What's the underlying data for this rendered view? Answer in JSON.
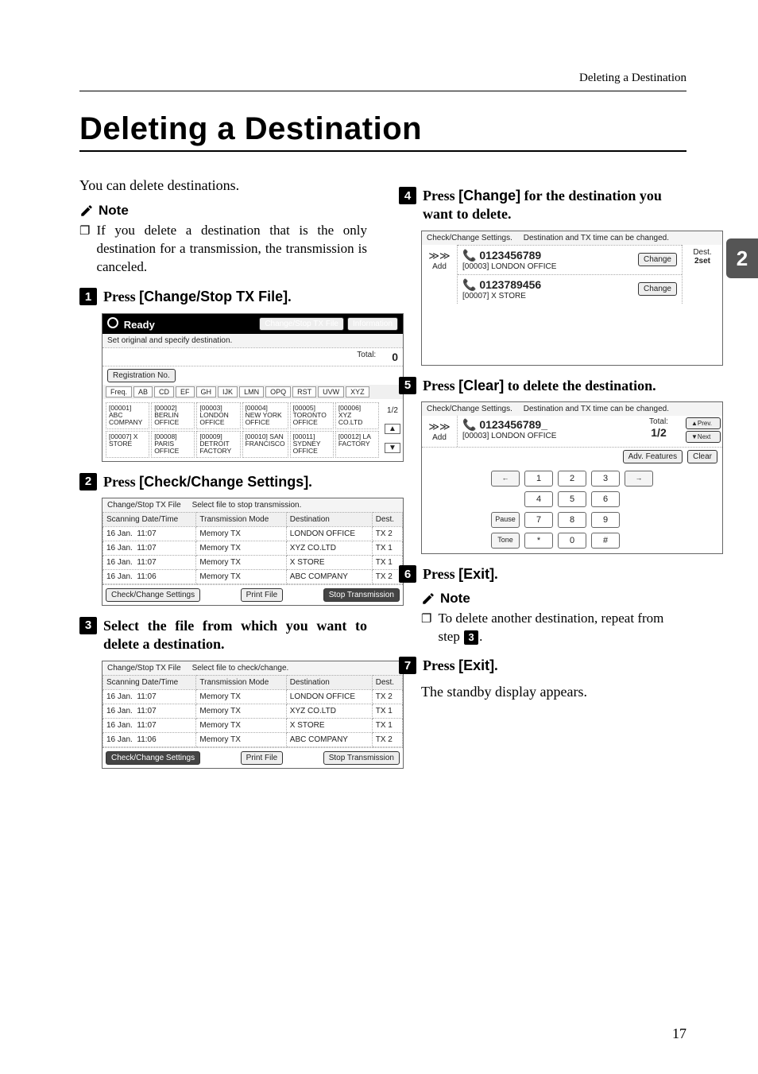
{
  "header_right": "Deleting a Destination",
  "side_tab": "2",
  "title": "Deleting a Destination",
  "intro": "You can delete destinations.",
  "note_label": "Note",
  "note_intro_bullet": "❐",
  "note_intro": "If you delete a destination that is the only destination for a transmission, the transmission is canceled.",
  "steps": {
    "s1": {
      "num": "1",
      "a": "Press ",
      "b": "[Change/Stop TX File]",
      "c": "."
    },
    "s2": {
      "num": "2",
      "a": "Press ",
      "b": "[Check/Change Settings]",
      "c": "."
    },
    "s3": {
      "num": "3",
      "text": "Select the file from which you want to delete a destination."
    },
    "s4": {
      "num": "4",
      "a": "Press ",
      "b": "[Change]",
      "c": " for the destination you want to delete."
    },
    "s5": {
      "num": "5",
      "a": "Press ",
      "b": "[Clear]",
      "c": " to delete the destination."
    },
    "s6": {
      "num": "6",
      "a": "Press ",
      "b": "[Exit]",
      "c": "."
    },
    "s7": {
      "num": "7",
      "a": "Press ",
      "b": "[Exit]",
      "c": "."
    }
  },
  "note2_a": "To delete another destination, repeat from step ",
  "note2_num": "3",
  "note2_b": ".",
  "standby": "The standby display appears.",
  "page_number": "17",
  "shot1": {
    "ready": "Ready",
    "btn_change": "Change/Stop TX File",
    "btn_info": "Information",
    "sub": "Set original and specify destination.",
    "total_label": "Total:",
    "total_value": "0",
    "reg": "Registration No.",
    "tabs": [
      "Freq.",
      "AB",
      "CD",
      "EF",
      "GH",
      "IJK",
      "LMN",
      "OPQ",
      "RST",
      "UVW",
      "XYZ"
    ],
    "cells": [
      "[00001] ABC COMPANY",
      "[00002] BERLIN OFFICE",
      "[00003] LONDON OFFICE",
      "[00004] NEW YORK OFFICE",
      "[00005] TORONTO OFFICE",
      "[00006] XYZ CO.LTD",
      "[00007] X STORE",
      "[00008] PARIS OFFICE",
      "[00009] DETROIT FACTORY",
      "[00010] SAN FRANCISCO",
      "[00011] SYDNEY OFFICE",
      "[00012] LA FACTORY"
    ],
    "page_ind": "1/2"
  },
  "shot_list": {
    "title": "Change/Stop TX File",
    "subtitle_a": "Select file to stop transmission.",
    "subtitle_b": "Select file to check/change.",
    "cols": [
      "Scanning Date/Time",
      "Transmission Mode",
      "Destination",
      "Dest."
    ],
    "rows": [
      [
        "16 Jan.",
        "11:07",
        "Memory TX",
        "LONDON OFFICE",
        "TX",
        "2"
      ],
      [
        "16 Jan.",
        "11:07",
        "Memory TX",
        "XYZ CO.LTD",
        "TX",
        "1"
      ],
      [
        "16 Jan.",
        "11:07",
        "Memory TX",
        "X STORE",
        "TX",
        "1"
      ],
      [
        "16 Jan.",
        "11:06",
        "Memory TX",
        "ABC COMPANY",
        "TX",
        "2"
      ]
    ],
    "btn_check": "Check/Change Settings",
    "btn_print": "Print File",
    "btn_stop": "Stop Transmission"
  },
  "shot4": {
    "title": "Check/Change Settings.",
    "sub": "Destination and TX time can be changed.",
    "add": "Add",
    "rows": [
      {
        "num": "0123456789",
        "sub": "[00003] LONDON OFFICE"
      },
      {
        "num": "0123789456",
        "sub": "[00007] X STORE"
      }
    ],
    "btn_change": "Change",
    "dest_label": "Dest.",
    "dest_count": "2set"
  },
  "shot5": {
    "title": "Check/Change Settings.",
    "sub": "Destination and TX time can be changed.",
    "add": "Add",
    "number": "0123456789_",
    "number_sub": "[00003] LONDON OFFICE",
    "total": "Total:",
    "total_frac": "1/2",
    "adv": "Adv. Features",
    "clear": "Clear",
    "prev": "▲Prev.",
    "next": "▼Next",
    "keys_rows": [
      [
        "←",
        "1",
        "2",
        "3",
        "→"
      ],
      [
        "",
        "4",
        "5",
        "6",
        ""
      ],
      [
        "Pause",
        "7",
        "8",
        "9",
        ""
      ],
      [
        "Tone",
        "*",
        "0",
        "#",
        ""
      ]
    ]
  }
}
